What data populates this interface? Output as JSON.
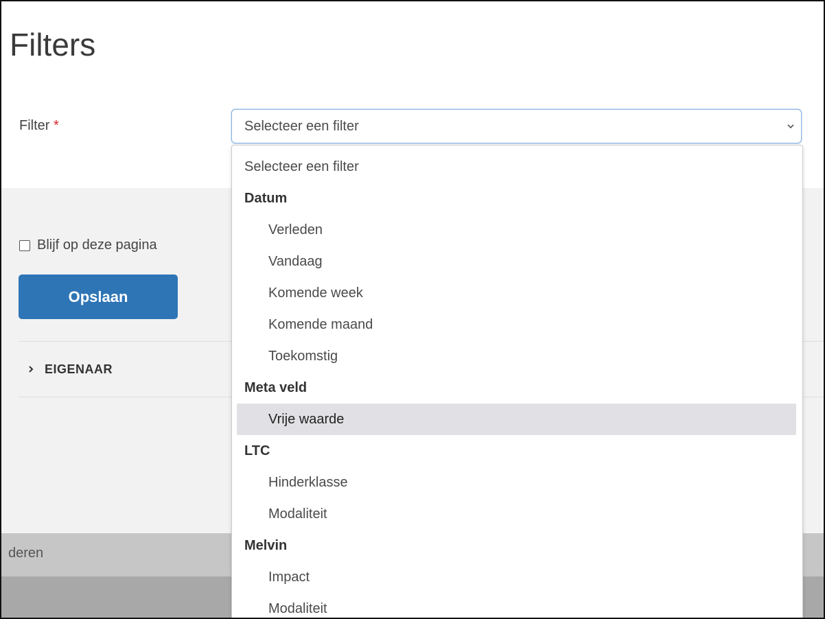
{
  "page": {
    "title": "Filters"
  },
  "form": {
    "filter_label": "Filter",
    "required_mark": "*",
    "selected_value": "Selecteer een filter"
  },
  "actions": {
    "stay_on_page": "Blijf op deze pagina",
    "stay_on_page_checked": false,
    "save": "Opslaan"
  },
  "sections": {
    "owner": "EIGENAAR"
  },
  "bottom_bar": {
    "text": "deren"
  },
  "dropdown": {
    "placeholder": "Selecteer een filter",
    "groups": [
      {
        "label": "Datum",
        "items": [
          "Verleden",
          "Vandaag",
          "Komende week",
          "Komende maand",
          "Toekomstig"
        ]
      },
      {
        "label": "Meta veld",
        "items": [
          "Vrije waarde"
        ]
      },
      {
        "label": "LTC",
        "items": [
          "Hinderklasse",
          "Modaliteit"
        ]
      },
      {
        "label": "Melvin",
        "items": [
          "Impact",
          "Modaliteit"
        ]
      }
    ],
    "highlighted": "Vrije waarde"
  },
  "colors": {
    "accent": "#2e75b6",
    "required": "#d9252a",
    "highlight": "#e1e1e5"
  }
}
